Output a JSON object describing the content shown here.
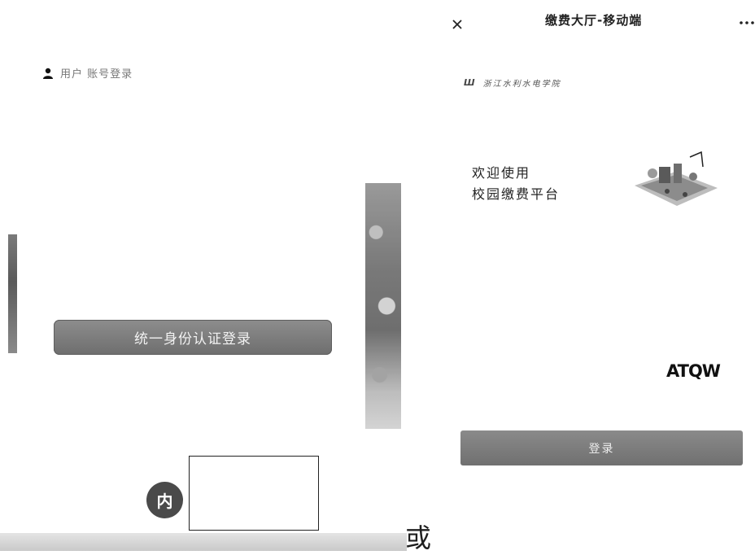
{
  "left": {
    "user_text": "用户 账号登录",
    "sso_button": "统一身份认证登录",
    "badge": "内",
    "or_text": "或"
  },
  "mobile": {
    "nav_title": "缴费大厅-移动端",
    "school_name": "浙江水利水电学院",
    "welcome_line1": "欢迎使用",
    "welcome_line2": "校园缴费平台",
    "captcha": "ATQW",
    "login_button": "登录"
  },
  "icons": {
    "user": "user-icon",
    "close": "close-icon",
    "more": "more-icon",
    "logo": "school-logo-icon",
    "illustration": "payment-illustration"
  }
}
